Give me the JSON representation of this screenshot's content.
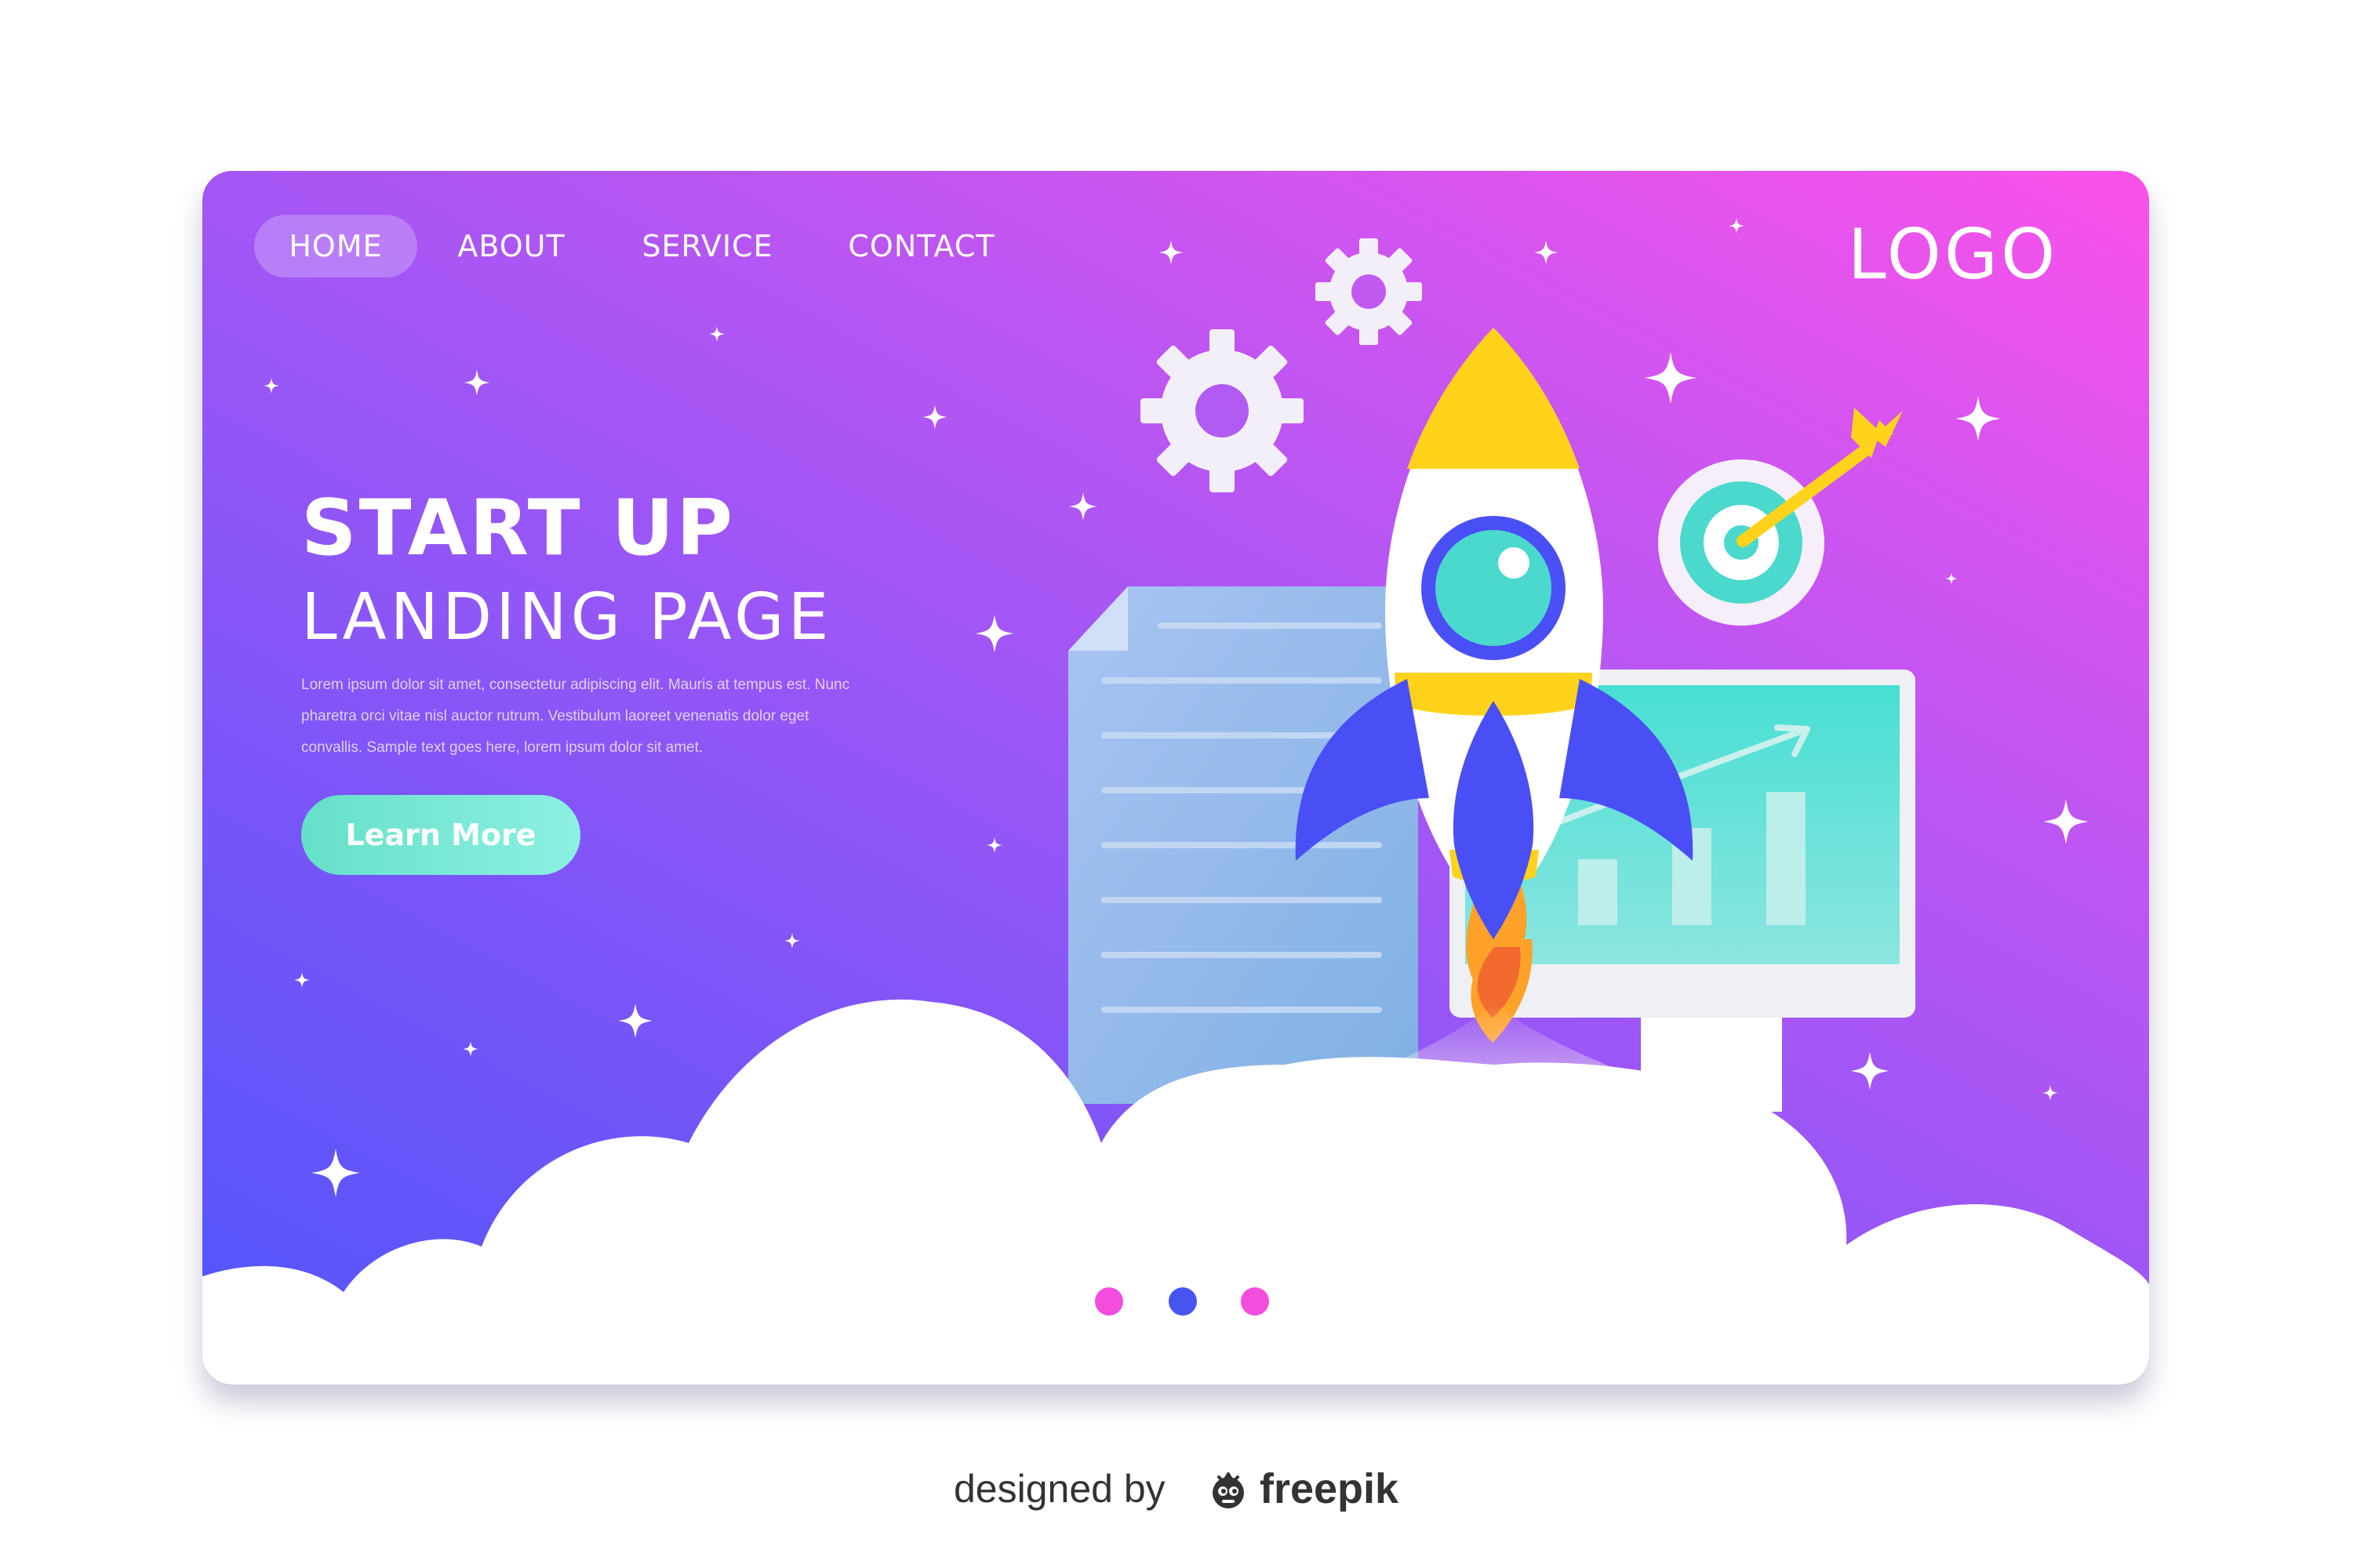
{
  "nav": {
    "items": [
      {
        "label": "HOME",
        "active": true
      },
      {
        "label": "ABOUT",
        "active": false
      },
      {
        "label": "SERVICE",
        "active": false
      },
      {
        "label": "CONTACT",
        "active": false
      }
    ]
  },
  "logo": {
    "text": "LOGO"
  },
  "hero": {
    "title": "START UP",
    "subtitle": "LANDING PAGE",
    "body": "Lorem ipsum dolor sit amet, consectetur adipiscing elit. Mauris at tempus est. Nunc pharetra orci vitae nisl auctor rutrum. Vestibulum laoreet venenatis dolor eget convallis. Sample text goes here, lorem ipsum dolor sit amet.",
    "cta_label": "Learn More"
  },
  "slider": {
    "dot_count": 3,
    "active_index": 1
  },
  "illustration": {
    "items": [
      "gear-icon",
      "gear-icon",
      "document-icon",
      "rocket-icon",
      "target-icon",
      "arrow-icon",
      "monitor-icon",
      "bar-chart-icon",
      "sparkle-icon",
      "cloud-icon"
    ]
  },
  "credit": {
    "prefix": "designed by",
    "brand": "freepik"
  },
  "colors": {
    "gradient_top_right": "#fb52e9",
    "gradient_bottom_left": "#4f55fb",
    "cta": "#66e0c8",
    "rocket_yellow": "#ffd31c",
    "rocket_blue": "#4a4ff5",
    "window_teal": "#4fe0d6",
    "dot_pink": "#f44dde",
    "dot_blue": "#4754f0",
    "cloud": "#ffffff"
  }
}
